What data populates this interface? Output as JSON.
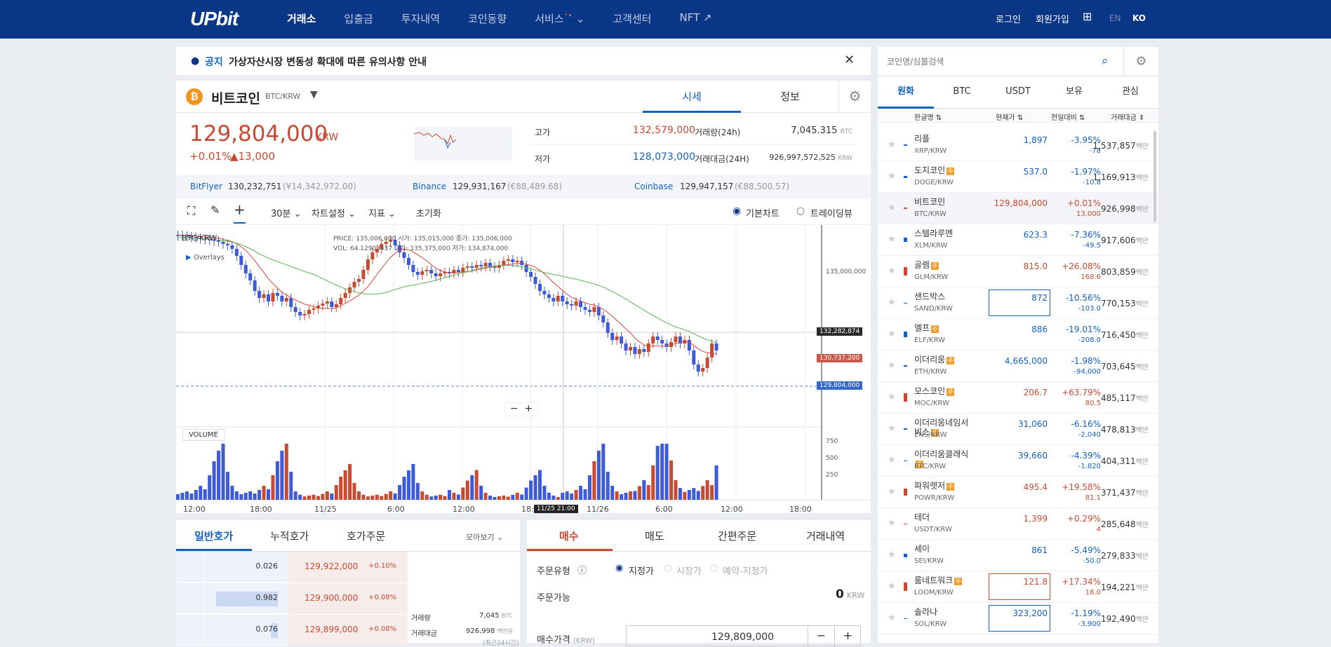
{
  "nav": {
    "logo": "UPbit",
    "items": [
      "거래소",
      "입출금",
      "투자내역",
      "코인동향",
      "서비스",
      "고객센터",
      "NFT ↗"
    ],
    "login": "로그인",
    "signup": "회원가입",
    "lang_en": "EN",
    "lang_ko": "KO"
  },
  "notice": {
    "label": "공지",
    "text": "가상자산시장 변동성 확대에 따른 유의사항 안내"
  },
  "coin": {
    "name": "비트코인",
    "pair": "BTC/KRW",
    "tab_price": "시세",
    "tab_info": "정보"
  },
  "price": {
    "current": "129,804,000",
    "unit": "KRW",
    "change_pct": "+0.01%",
    "change_amt": "▲13,000",
    "high_label": "고가",
    "high": "132,579,000",
    "low_label": "저가",
    "low": "128,073,000",
    "vol_label": "거래량(24h)",
    "vol": "7,045.315",
    "vol_unit": "BTC",
    "amt_label": "거래대금(24H)",
    "amt": "926,997,572,525",
    "amt_unit": "KRW"
  },
  "exchanges": [
    {
      "name": "BitFlyer",
      "price": "130,232,751",
      "sub": "(¥14,342,972.00)"
    },
    {
      "name": "Binance",
      "price": "129,931,167",
      "sub": "(€88,489.68)"
    },
    {
      "name": "Coinbase",
      "price": "129,947,157",
      "sub": "(€88,500.57)"
    }
  ],
  "tools": {
    "interval": "30분",
    "chart_settings": "차트설정",
    "indicators": "지표",
    "reset": "초기화",
    "basic_chart": "기본차트",
    "tradingview": "트레이딩뷰"
  },
  "chart": {
    "symbol": "BTC/KRW",
    "overlays": "Overlays",
    "volume": "VOLUME",
    "ohlc": "PRICE: 135,006,000   시가: 135,015,000   종가: 135,006,000",
    "ohlc2": "VOL: 64.12903437   고가: 135,375,000   저가: 134,874,000",
    "price_tick": "135,000,000",
    "label_ma_long": "132,282,874",
    "label_ma_short": "130,737,200",
    "label_last": "129,804,000",
    "vol_ticks": [
      "750",
      "500",
      "250"
    ],
    "x_labels": [
      "12:00",
      "18:00",
      "11/25",
      "6:00",
      "12:00",
      "18:00",
      "11/26",
      "6:00",
      "12:00",
      "18:00"
    ],
    "crosshair_time": "11/25 21:00"
  },
  "chart_data": {
    "type": "candlestick",
    "x_labels": [
      "12:00",
      "18:00",
      "11/25",
      "6:00",
      "12:00",
      "18:00",
      "11/26",
      "6:00",
      "12:00",
      "18:00"
    ],
    "y_tick": "135,000,000",
    "last": "129,804,000",
    "ma_a": "132,282,874",
    "ma_b": "130,737,200"
  },
  "orderbook": {
    "tabs": [
      "일반호가",
      "누적호가",
      "호가주문"
    ],
    "view": "모아보기",
    "rows": [
      {
        "qty": "0.026",
        "price": "129,922,000",
        "pct": "+0.10%"
      },
      {
        "qty": "0.982",
        "price": "129,900,000",
        "pct": "+0.08%"
      },
      {
        "qty": "0.076",
        "price": "129,899,000",
        "pct": "+0.08%"
      }
    ],
    "vol_label": "거래량",
    "vol": "7,045",
    "vol_unit": "BTC",
    "amt_label": "거래대금",
    "amt": "926,998",
    "amt_unit": "백만원",
    "amt_note": "(최근24시간)"
  },
  "order": {
    "tabs": [
      "매수",
      "매도",
      "간편주문",
      "거래내역"
    ],
    "type_label": "주문유형",
    "types": [
      "지정가",
      "시장가",
      "예약-지정가"
    ],
    "avail_label": "주문가능",
    "avail": "0",
    "avail_unit": "KRW",
    "price_label": "매수가격",
    "price_unit": "(KRW)",
    "price_val": "129,809,000"
  },
  "side": {
    "search_placeholder": "코인명/심볼검색",
    "tabs": [
      "원화",
      "BTC",
      "USDT",
      "보유",
      "관심"
    ],
    "cols": [
      "한글명",
      "현재가",
      "전일대비",
      "거래대금"
    ],
    "coins": [
      {
        "name": "리플",
        "sym": "XRP/KRW",
        "price": "1,897",
        "pct": "-3.95%",
        "chg": "-78",
        "vol": "1,537,857"
      },
      {
        "name": "도지코인",
        "sym": "DOGE/KRW",
        "price": "537.0",
        "pct": "-1.97%",
        "chg": "-10.8",
        "vol": "1,169,913"
      },
      {
        "name": "비트코인",
        "sym": "BTC/KRW",
        "price": "129,804,000",
        "pct": "+0.01%",
        "chg": "13,000",
        "vol": "926,998"
      },
      {
        "name": "스텔라루멘",
        "sym": "XLM/KRW",
        "price": "623.3",
        "pct": "-7.36%",
        "chg": "-49.5",
        "vol": "917,606"
      },
      {
        "name": "골렘",
        "sym": "GLM/KRW",
        "price": "815.0",
        "pct": "+26.08%",
        "chg": "168.6",
        "vol": "803,859"
      },
      {
        "name": "샌드박스",
        "sym": "SAND/KRW",
        "price": "872",
        "pct": "-10.56%",
        "chg": "-103.0",
        "vol": "770,153"
      },
      {
        "name": "엘프",
        "sym": "ELF/KRW",
        "price": "886",
        "pct": "-19.01%",
        "chg": "-208.0",
        "vol": "716,450"
      },
      {
        "name": "이더리움",
        "sym": "ETH/KRW",
        "price": "4,665,000",
        "pct": "-1.98%",
        "chg": "-94,000",
        "vol": "703,645"
      },
      {
        "name": "모스코인",
        "sym": "MOC/KRW",
        "price": "206.7",
        "pct": "+63.79%",
        "chg": "80.5",
        "vol": "485,117"
      },
      {
        "name": "이더리움네임서비스",
        "sym": "ENS/KRW",
        "price": "31,060",
        "pct": "-6.16%",
        "chg": "-2,040",
        "vol": "478,813"
      },
      {
        "name": "이더리움클래식",
        "sym": "ETC/KRW",
        "price": "39,660",
        "pct": "-4.39%",
        "chg": "-1,820",
        "vol": "404,311"
      },
      {
        "name": "파워렛저",
        "sym": "POWR/KRW",
        "price": "495.4",
        "pct": "+19.58%",
        "chg": "81.1",
        "vol": "371,437"
      },
      {
        "name": "테더",
        "sym": "USDT/KRW",
        "price": "1,399",
        "pct": "+0.29%",
        "chg": "4",
        "vol": "285,648"
      },
      {
        "name": "세이",
        "sym": "SEI/KRW",
        "price": "861",
        "pct": "-5.49%",
        "chg": "-50.0",
        "vol": "279,833"
      },
      {
        "name": "룸네트워크",
        "sym": "LOOM/KRW",
        "price": "121.8",
        "pct": "+17.34%",
        "chg": "18.0",
        "vol": "194,221"
      },
      {
        "name": "솔라나",
        "sym": "SOL/KRW",
        "price": "323,200",
        "pct": "-1.19%",
        "chg": "-3,900",
        "vol": "192,490"
      }
    ],
    "unit": "백만"
  },
  "colors": {
    "brand": "#093687",
    "up": "#c84a31",
    "down": "#1261c4"
  }
}
